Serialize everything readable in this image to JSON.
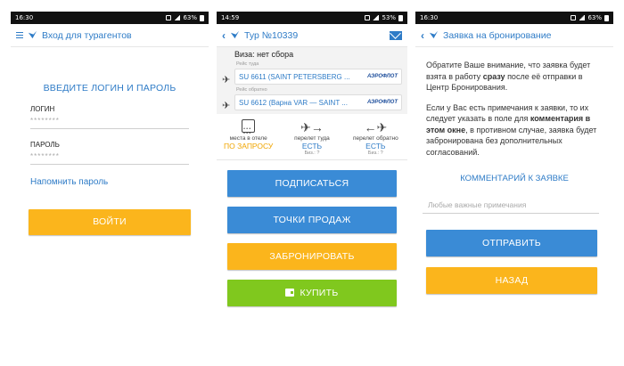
{
  "screens": {
    "login": {
      "status": {
        "time": "16:30",
        "battery": "63%"
      },
      "title": "Вход для турагентов",
      "heading": "ВВЕДИТЕ ЛОГИН И ПАРОЛЬ",
      "login_label": "ЛОГИН",
      "login_value": "********",
      "password_label": "ПАРОЛЬ",
      "password_value": "********",
      "remind_link": "Напомнить пароль",
      "submit_label": "ВОЙТИ"
    },
    "tour": {
      "status": {
        "time": "14:59",
        "battery": "53%"
      },
      "title": "Тур №10339",
      "visa": "Виза: нет сбора",
      "outbound": {
        "label": "Рейс туда",
        "flight": "SU 6611 (SAINT PETERSBERG ...",
        "airline": "АЭРОФЛОТ"
      },
      "inbound": {
        "label": "Рейс обратно",
        "flight": "SU 6612 (Варна VAR — SAINT ...",
        "airline": "АЭРОФЛОТ"
      },
      "stats": [
        {
          "label": "места в отеле",
          "value": "ПО ЗАПРОСУ",
          "sub": ""
        },
        {
          "label": "перелет туда",
          "value": "ЕСТЬ",
          "sub": "Биз.: ?"
        },
        {
          "label": "перелет обратно",
          "value": "ЕСТЬ",
          "sub": "Биз.: ?"
        }
      ],
      "buttons": {
        "subscribe": "ПОДПИСАТЬСЯ",
        "points": "ТОЧКИ ПРОДАЖ",
        "book": "ЗАБРОНИРОВАТЬ",
        "buy": "КУПИТЬ"
      }
    },
    "booking": {
      "status": {
        "time": "16:30",
        "battery": "63%"
      },
      "title": "Заявка на бронирование",
      "para1_a": "Обратите Ваше внимание, что заявка будет взята в работу ",
      "para1_b": "сразу",
      "para1_c": " после её отправки в Центр Бронирования.",
      "para2_a": "Если у Вас есть примечания к заявки, то их следует указать в поле для ",
      "para2_b": "комментария в этом окне",
      "para2_c": ", в противном случае, заявка будет забронирована без дополнительных согласований.",
      "comment_heading": "КОММЕНТАРИЙ К ЗАЯВКЕ",
      "comment_placeholder": "Любые важные примечания",
      "send_label": "ОТПРАВИТЬ",
      "back_label": "НАЗАД"
    }
  },
  "colors": {
    "accent": "#2f7cc7",
    "orange": "#fbb51c",
    "blue_button": "#3a8bd6",
    "green_button": "#80c81e"
  }
}
